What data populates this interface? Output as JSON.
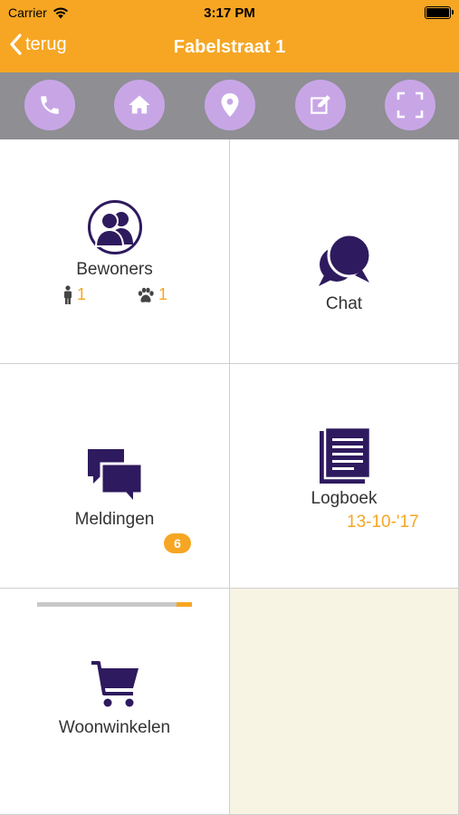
{
  "status_bar": {
    "carrier": "Carrier",
    "time": "3:17 PM"
  },
  "nav": {
    "back_label": "terug",
    "title": "Fabelstraat 1"
  },
  "actions": [
    {
      "name": "phone",
      "icon": "phone-icon"
    },
    {
      "name": "home",
      "icon": "home-icon"
    },
    {
      "name": "location",
      "icon": "map-pin-icon"
    },
    {
      "name": "note",
      "icon": "edit-icon"
    },
    {
      "name": "scan",
      "icon": "scan-frame-icon"
    }
  ],
  "tiles": {
    "bewoners": {
      "label": "Bewoners",
      "icon": "residents-icon",
      "persons": "1",
      "pets": "1"
    },
    "chat": {
      "label": "Chat",
      "icon": "chat-bubbles-icon"
    },
    "meldingen": {
      "label": "Meldingen",
      "icon": "messages-icon",
      "badge": "6"
    },
    "logboek": {
      "label": "Logboek",
      "icon": "logbook-icon",
      "date": "13-10-'17"
    },
    "woonwinkelen": {
      "label": "Woonwinkelen",
      "icon": "shopping-cart-icon",
      "progress": 0.1
    }
  },
  "colors": {
    "accent": "#F6A623",
    "action_bar": "#8E8E93",
    "action_button": "#C8A6E6",
    "icon": "#2E1A5E",
    "empty_tile": "#F8F4E3"
  }
}
